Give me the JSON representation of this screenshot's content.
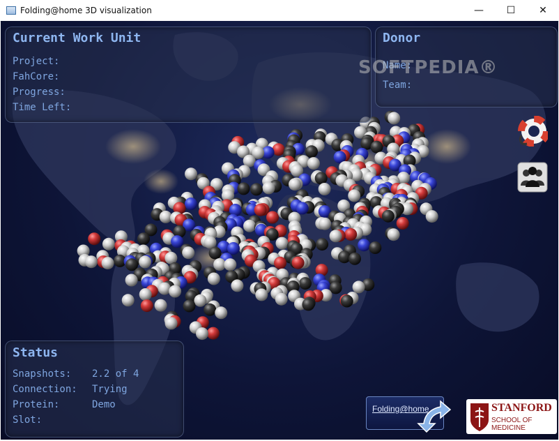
{
  "window": {
    "title": "Folding@home 3D visualization",
    "minimize_glyph": "—",
    "maximize_glyph": "☐",
    "close_glyph": "✕"
  },
  "work_unit": {
    "title": "Current Work Unit",
    "project_label": "Project:",
    "fahcore_label": "FahCore:",
    "progress_label": "Progress:",
    "time_left_label": "Time Left:"
  },
  "donor": {
    "title": "Donor",
    "name_label": "Name:",
    "team_label": "Team:"
  },
  "status": {
    "title": "Status",
    "snapshots_label": "Snapshots:",
    "snapshots_value": "2.2 of 4",
    "connection_label": "Connection:",
    "connection_value": "Trying",
    "protein_label": "Protein:",
    "protein_value": "Demo",
    "slot_label": "Slot:"
  },
  "watermark": "SOFTPEDIA®",
  "logos": {
    "fah": "Folding@home",
    "stanford_name": "STANFORD",
    "stanford_sub": "SCHOOL OF MEDICINE"
  },
  "icons": {
    "help": "lifebuoy-icon",
    "users": "users-group-icon"
  },
  "colors": {
    "panel_text": "#7fa6e0",
    "panel_title": "#8eb6f0",
    "atom_oxygen": "#d23a3a",
    "atom_nitrogen": "#3a46d8",
    "atom_carbon": "#3a3a3a",
    "atom_hydrogen": "#d8d8d8"
  }
}
